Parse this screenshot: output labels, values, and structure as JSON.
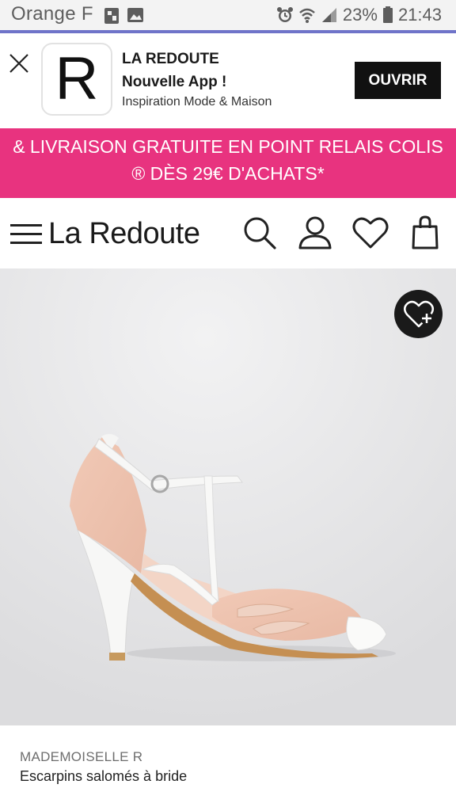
{
  "status_bar": {
    "carrier": "Orange F",
    "battery": "23%",
    "time": "21:43",
    "icons": [
      "sim-icon",
      "image-icon",
      "alarm-icon",
      "wifi-icon",
      "signal-icon",
      "battery-icon"
    ]
  },
  "app_banner": {
    "logo_letter": "R",
    "title": "LA REDOUTE",
    "subtitle": "Nouvelle App !",
    "tagline": "Inspiration Mode & Maison",
    "open_label": "OUVRIR"
  },
  "promo": {
    "line1": "& LIVRAISON GRATUITE EN POINT RELAIS COLIS",
    "line2": "® DÈS 29€ D'ACHATS*",
    "color": "#e8337f"
  },
  "header": {
    "brand": "La Redoute",
    "icons": [
      "menu-icon",
      "search-icon",
      "account-icon",
      "wishlist-icon",
      "bag-icon"
    ]
  },
  "product": {
    "brand": "MADEMOISELLE R",
    "name": "Escarpins salomés à bride",
    "image": "pink-white-t-bar-pump"
  }
}
